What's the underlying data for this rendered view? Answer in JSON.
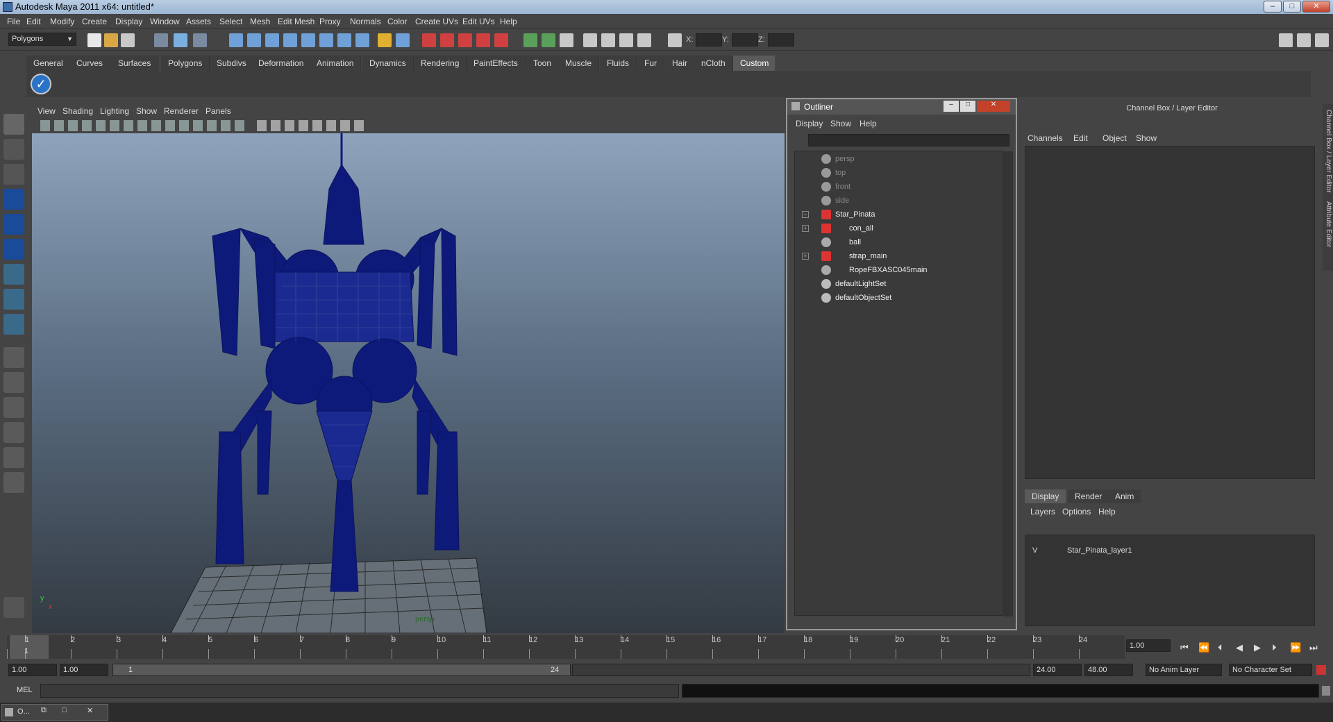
{
  "window": {
    "title": "Autodesk Maya 2011 x64: untitled*"
  },
  "menubar": [
    "File",
    "Edit",
    "Modify",
    "Create",
    "Display",
    "Window",
    "Assets",
    "Select",
    "Mesh",
    "Edit Mesh",
    "Proxy",
    "Normals",
    "Color",
    "Create UVs",
    "Edit UVs",
    "Help"
  ],
  "status": {
    "mode": "Polygons",
    "x_label": "X:",
    "y_label": "Y:",
    "z_label": "Z:"
  },
  "shelf": {
    "tabs": [
      "General",
      "Curves",
      "Surfaces",
      "Polygons",
      "Subdivs",
      "Deformation",
      "Animation",
      "Dynamics",
      "Rendering",
      "PaintEffects",
      "Toon",
      "Muscle",
      "Fluids",
      "Fur",
      "Hair",
      "nCloth",
      "Custom"
    ],
    "active": "Custom"
  },
  "viewport": {
    "menu": [
      "View",
      "Shading",
      "Lighting",
      "Show",
      "Renderer",
      "Panels"
    ],
    "camera_label": "persp",
    "axis_y": "y",
    "axis_x": "x"
  },
  "outliner": {
    "title": "Outliner",
    "menu": [
      "Display",
      "Show",
      "Help"
    ],
    "items": [
      {
        "label": "persp",
        "dim": true
      },
      {
        "label": "top",
        "dim": true
      },
      {
        "label": "front",
        "dim": true
      },
      {
        "label": "side",
        "dim": true
      },
      {
        "label": "Star_Pinata",
        "dim": false
      },
      {
        "label": "con_all",
        "dim": false
      },
      {
        "label": "ball",
        "dim": false
      },
      {
        "label": "strap_main",
        "dim": false
      },
      {
        "label": "RopeFBXASC045main",
        "dim": false
      },
      {
        "label": "defaultLightSet",
        "dim": false
      },
      {
        "label": "defaultObjectSet",
        "dim": false
      }
    ],
    "expand_minus": "−",
    "expand_plus": "+"
  },
  "channelbox": {
    "header": "Channel Box / Layer Editor",
    "menu": [
      "Channels",
      "Edit",
      "Object",
      "Show"
    ],
    "layer_tabs": [
      "Display",
      "Render",
      "Anim"
    ],
    "layer_menu": [
      "Layers",
      "Options",
      "Help"
    ],
    "layer_visible": "V",
    "layer_name": "Star_Pinata_layer1",
    "side_tab_1": "Channel Box / Layer Editor",
    "side_tab_2": "Attribute Editor"
  },
  "timeline": {
    "ticks": [
      "1",
      "2",
      "3",
      "4",
      "5",
      "6",
      "7",
      "8",
      "9",
      "10",
      "11",
      "12",
      "13",
      "14",
      "15",
      "16",
      "17",
      "18",
      "19",
      "20",
      "21",
      "22",
      "23",
      "24"
    ],
    "current_frame": "1",
    "current_time": "1.00"
  },
  "range": {
    "start": "1.00",
    "start2": "1.00",
    "slider_start": "1",
    "slider_end": "24",
    "end": "24.00",
    "end2": "48.00",
    "anim_layer": "No Anim Layer",
    "char_set": "No Character Set"
  },
  "cmdline": {
    "label": "MEL"
  },
  "taskbar": {
    "item": "O..."
  }
}
